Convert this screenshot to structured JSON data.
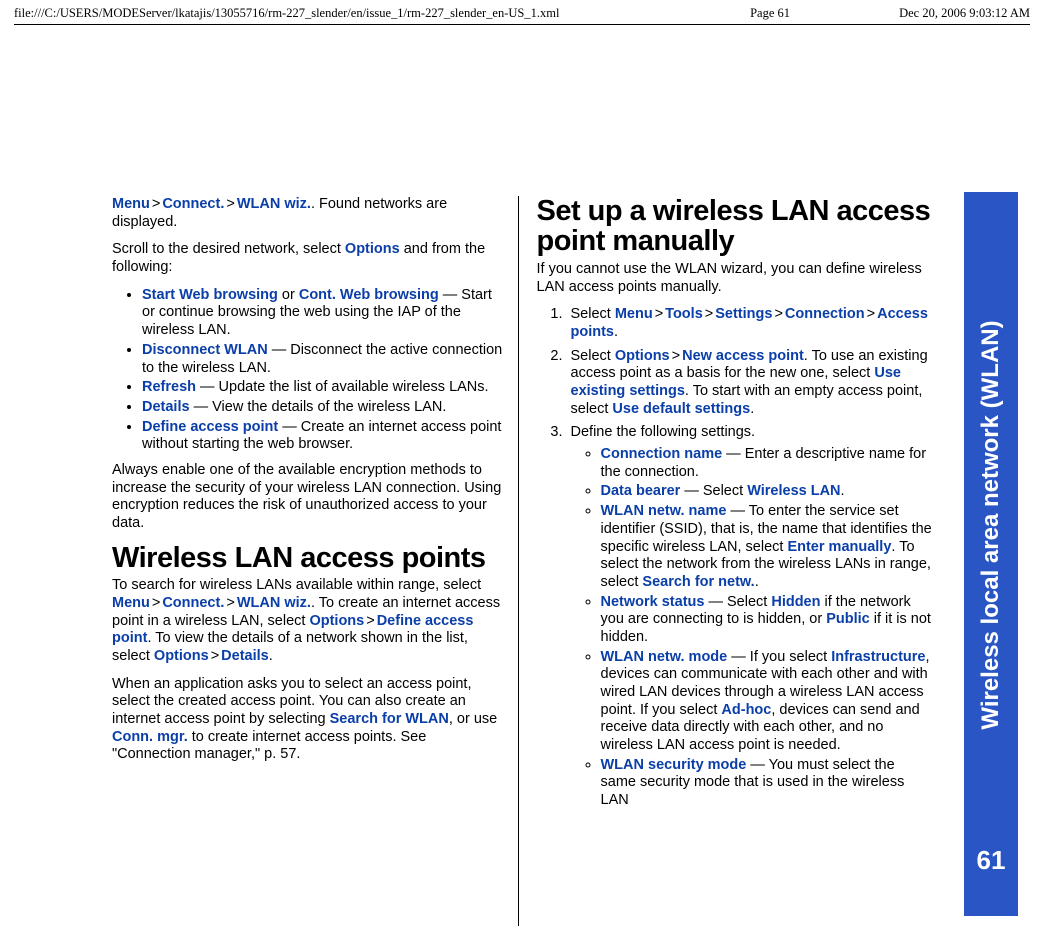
{
  "header": {
    "path": "file:///C:/USERS/MODEServer/lkatajis/13055716/rm-227_slender/en/issue_1/rm-227_slender_en-US_1.xml",
    "page_label": "Page 61",
    "timestamp": "Dec 20, 2006 9:03:12 AM"
  },
  "side_tab": {
    "title": "Wireless local area network (WLAN)",
    "page_number": "61"
  },
  "left": {
    "p1_a": "Menu",
    "p1_b": "Connect.",
    "p1_c": "WLAN wiz.",
    "p1_rest": ". Found networks are displayed.",
    "p2_a": "Scroll to the desired network, select ",
    "p2_hl": "Options",
    "p2_b": " and from the following:",
    "bullets": {
      "b1_a": "Start Web browsing",
      "b1_mid": " or ",
      "b1_b": "Cont. Web browsing",
      "b1_rest": " — Start or continue browsing the web using the IAP of the wireless LAN.",
      "b2_a": "Disconnect WLAN",
      "b2_rest": " — Disconnect the active connection to the wireless LAN.",
      "b3_a": "Refresh",
      "b3_rest": " — Update the list of available wireless LANs.",
      "b4_a": "Details",
      "b4_rest": " — View the details of the wireless LAN.",
      "b5_a": "Define access point",
      "b5_rest": " — Create an internet access point without starting the web browser."
    },
    "p3": "Always enable one of the available encryption methods to increase the security of your wireless LAN connection. Using encryption reduces the risk of unauthorized access to your data.",
    "h1": "Wireless LAN access points",
    "p4_a": "To search for wireless LANs available within range, select ",
    "p4_m1": "Menu",
    "p4_m2": "Connect.",
    "p4_m3": "WLAN wiz.",
    "p4_b": ". To create an internet access point in a wireless LAN, select ",
    "p4_m4": "Options",
    "p4_m5": "Define access point",
    "p4_c": ". To view the details of a network shown in the list, select ",
    "p4_m6": "Options",
    "p4_m7": "Details",
    "p4_d": ".",
    "p5_a": "When an application asks you to select an access point, select the created access point. You can also create an internet access point by selecting ",
    "p5_hl1": "Search for WLAN",
    "p5_b": ", or use ",
    "p5_hl2": "Conn. mgr.",
    "p5_c": " to create internet access points. See \"Connection manager,\" p. 57."
  },
  "right": {
    "h1": "Set up a wireless LAN access point manually",
    "p1": "If you cannot use the WLAN wizard, you can define wireless LAN access points manually.",
    "ol1": {
      "a": "Select ",
      "m1": "Menu",
      "m2": "Tools",
      "m3": "Settings",
      "m4": "Connection",
      "m5": "Access points",
      "end": "."
    },
    "ol2": {
      "a": "Select ",
      "m1": "Options",
      "m2": "New access point",
      "b": ". To use an existing access point as a basis for the new one, select ",
      "m3": "Use existing settings",
      "c": ". To start with an empty access point, select ",
      "m4": "Use default settings",
      "d": "."
    },
    "ol3_intro": "Define the following settings.",
    "sub": {
      "s1_a": "Connection name",
      "s1_rest": " — Enter a descriptive name for the connection.",
      "s2_a": "Data bearer",
      "s2_mid": " — Select ",
      "s2_b": "Wireless LAN",
      "s2_end": ".",
      "s3_a": "WLAN netw. name",
      "s3_b": " — To enter the service set identifier (SSID), that is, the name that identifies the specific wireless LAN, select ",
      "s3_c": "Enter manually",
      "s3_d": ". To select the network from the wireless LANs in range, select ",
      "s3_e": "Search for netw.",
      "s3_f": ".",
      "s4_a": "Network status",
      "s4_b": " — Select ",
      "s4_c": "Hidden",
      "s4_d": " if the network you are connecting to is hidden, or ",
      "s4_e": "Public",
      "s4_f": " if it is not hidden.",
      "s5_a": "WLAN netw. mode",
      "s5_b": " — If you select ",
      "s5_c": "Infrastructure",
      "s5_d": ", devices can communicate with each other and with wired LAN devices through a wireless LAN access point. If you select ",
      "s5_e": "Ad-hoc",
      "s5_f": ", devices can send and receive data directly with each other, and no wireless LAN access point is needed.",
      "s6_a": "WLAN security mode",
      "s6_b": " — You must select the same security mode that is used in the wireless LAN"
    }
  },
  "gt": ">"
}
